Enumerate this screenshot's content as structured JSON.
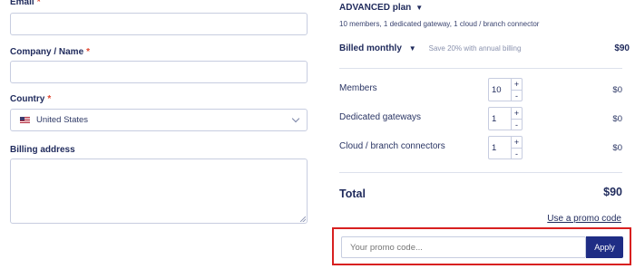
{
  "form": {
    "email_label": "Email",
    "company_label": "Company / Name",
    "country_label": "Country",
    "country_value": "United States",
    "billing_address_label": "Billing address",
    "required_mark": "*"
  },
  "summary": {
    "plan_name": "ADVANCED plan",
    "plan_caret": "▼",
    "plan_description": "10 members, 1 dedicated gateway, 1 cloud / branch connector",
    "billing_period": "Billed monthly",
    "billing_caret": "▼",
    "annual_saving_note": "Save 20% with annual billing",
    "plan_price": "$90",
    "items": [
      {
        "name": "Members",
        "quantity": "10",
        "cost": "$0"
      },
      {
        "name": "Dedicated gateways",
        "quantity": "1",
        "cost": "$0"
      },
      {
        "name": "Cloud / branch connectors",
        "quantity": "1",
        "cost": "$0"
      }
    ],
    "stepper_plus": "+",
    "stepper_minus": "-",
    "total_label": "Total",
    "total_value": "$90",
    "promo_link": "Use a promo code",
    "promo_placeholder": "Your promo code...",
    "apply_label": "Apply"
  },
  "colors": {
    "primary": "#1f2d85",
    "required": "#e0462f",
    "highlight_border": "#d82020"
  },
  "icons": {
    "country_flag": "us-flag-icon",
    "dropdown": "chevron-down-icon"
  }
}
